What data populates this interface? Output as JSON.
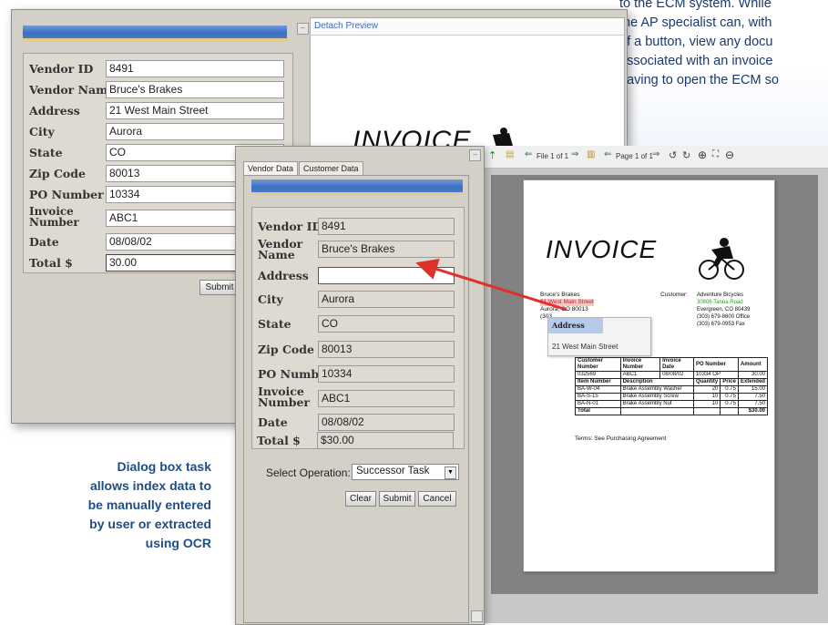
{
  "blurb": {
    "lines": [
      "to the ECM system. While",
      "the AP specialist can, with",
      "of a button, view any docu",
      "associated with an invoice",
      "having to open the ECM so"
    ]
  },
  "back_dialog": {
    "detach_link": "Detach Preview",
    "fields": [
      {
        "label": "Vendor ID",
        "value": "8491"
      },
      {
        "label": "Vendor Name",
        "value": "Bruce's Brakes"
      },
      {
        "label": "Address",
        "value": "21 West Main Street"
      },
      {
        "label": "City",
        "value": "Aurora"
      },
      {
        "label": "State",
        "value": "CO"
      },
      {
        "label": "Zip Code",
        "value": "80013"
      },
      {
        "label": "PO Number",
        "value": "10334"
      },
      {
        "label": "Invoice Number",
        "value": "ABC1"
      },
      {
        "label": "Date",
        "value": "08/08/02"
      },
      {
        "label": "Total $",
        "value": "30.00"
      }
    ],
    "submit_label": "Submit",
    "invoice_title": "INVOICE"
  },
  "front_dialog": {
    "tabs": [
      "Vendor Data",
      "Customer Data"
    ],
    "fields": [
      {
        "label": "Vendor ID",
        "value": "8491"
      },
      {
        "label": "Vendor Name",
        "value": "Bruce's Brakes"
      },
      {
        "label": "Address",
        "value": ""
      },
      {
        "label": "City",
        "value": "Aurora"
      },
      {
        "label": "State",
        "value": "CO"
      },
      {
        "label": "Zip Code",
        "value": "80013"
      },
      {
        "label": "PO Number",
        "value": "10334"
      },
      {
        "label": "Invoice Number",
        "value": "ABC1"
      },
      {
        "label": "Date",
        "value": "08/08/02"
      },
      {
        "label": "Total $",
        "value": "$30.00"
      }
    ],
    "select_operation_label": "Select Operation:",
    "select_operation_value": "Successor Task",
    "clear_label": "Clear",
    "submit_label": "Submit",
    "cancel_label": "Cancel"
  },
  "preview": {
    "file_label": "File 1 of 1",
    "page_label": "Page 1 of 1",
    "invoice": {
      "title": "INVOICE",
      "vendor_lines": [
        "Bruce's Brakes",
        "21 West Main Street",
        "Aurora, CO 80013",
        "(303"
      ],
      "customer_label": "Customer:",
      "customer_lines": [
        "Adventure Bicycles",
        "30806 Tanoa Road",
        "Evergreen, CO 80439",
        "(303) 679-8600 Office",
        "(303) 679-0953 Fax"
      ],
      "popup_title": "Address",
      "popup_value": "21 West Main Street",
      "table_header1": [
        "Customer Number",
        "Invoice Number",
        "Invoice Date",
        "PO Number",
        "Amount"
      ],
      "table_row1": [
        "032569",
        "ABC1",
        "08/08/02",
        "10334 OP",
        "30.00"
      ],
      "table_header2": [
        "Item Number",
        "Description",
        "Quantity",
        "Price",
        "Extended"
      ],
      "items": [
        [
          "BA-W-04",
          "Brake Assembly Washer",
          "20",
          "0.75",
          "15.00"
        ],
        [
          "BA-S-15",
          "Brake Assembly Screw",
          "10",
          "0.75",
          "7.50"
        ],
        [
          "BA-N-01",
          "Brake Assembly Nut",
          "10",
          "0.75",
          "7.50"
        ]
      ],
      "total_label": "Total",
      "total_value": "$30.00",
      "terms": "Terms:  See Purchasing Agreement"
    }
  },
  "caption": {
    "lines": [
      "Dialog box task",
      "allows index data to",
      "be manually entered",
      "by user or extracted",
      "using OCR"
    ]
  },
  "colors": {
    "arrow": "#e0302a",
    "caption": "#1f4d86",
    "blurb": "#1a3a6e",
    "highlight": "#f4c6c6"
  }
}
